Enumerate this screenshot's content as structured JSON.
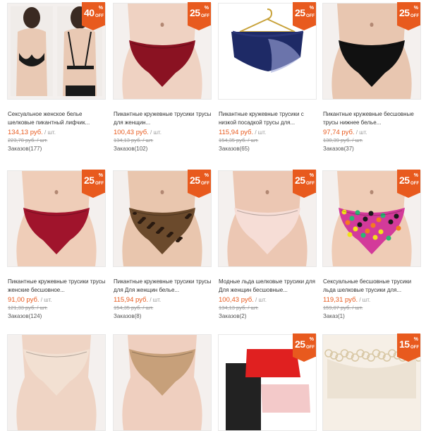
{
  "products": [
    {
      "discount": "40",
      "title": "Сексуальное женское белье шелковые пикантный лифчик...",
      "price": "134,13 руб.",
      "unit": "/ шт.",
      "old_price": "223,78 руб. / шт.",
      "orders": "Заказов(177)",
      "img": "bra-black",
      "skin": "#e9c9b4",
      "garment": "#1a1a1a"
    },
    {
      "discount": "25",
      "title": "Пикантные кружевные трусики трусы для женщин...",
      "price": "100,43 руб.",
      "unit": "/ шт.",
      "old_price": "134,13 руб. / шт.",
      "orders": "Заказов(102)",
      "img": "panty",
      "skin": "#efd2c2",
      "garment": "#8a1222"
    },
    {
      "discount": "25",
      "title": "Пикантные кружевные трусики с низкой посадкой трусы для...",
      "price": "115,94 руб.",
      "unit": "/ шт.",
      "old_price": "154,35 руб. / шт.",
      "orders": "Заказов(65)",
      "img": "hanger",
      "skin": "#ffffff",
      "garment": "#1e2a66"
    },
    {
      "discount": "25",
      "title": "Пикантные кружевные бесшовные трусы нижнее белье...",
      "price": "97,74 руб.",
      "unit": "/ шт.",
      "old_price": "130,39 руб. / шт.",
      "orders": "Заказов(37)",
      "img": "panty",
      "skin": "#e8c6b0",
      "garment": "#111111"
    },
    {
      "discount": "25",
      "title": "Пикантные кружевные трусики трусы женские бесшовное...",
      "price": "91,00 руб.",
      "unit": "/ шт.",
      "old_price": "121,33 руб. / шт.",
      "orders": "Заказов(124)",
      "img": "panty",
      "skin": "#efcdb8",
      "garment": "#a0142c"
    },
    {
      "discount": "25",
      "title": "Пикантные кружевные трусики трусы для Для женщин белье...",
      "price": "115,94 руб.",
      "unit": "/ шт.",
      "old_price": "154,35 руб. / шт.",
      "orders": "Заказов(8)",
      "img": "leopard",
      "skin": "#e9c6ae",
      "garment": "#6b4a2c"
    },
    {
      "discount": "25",
      "title": "Модные льда шелковые трусики для Для женщин бесшовные...",
      "price": "100,43 руб.",
      "unit": "/ шт.",
      "old_price": "134,13 руб. / шт.",
      "orders": "Заказов(2)",
      "img": "panty",
      "skin": "#ecc7b3",
      "garment": "#f6ddd6"
    },
    {
      "discount": "25",
      "title": "Сексуальные бесшовные трусики льда шелковые трусики для...",
      "price": "119,31 руб.",
      "unit": "/ шт.",
      "old_price": "159,07 руб. / шт.",
      "orders": "Заказ(1)",
      "img": "floral",
      "skin": "#efccb6",
      "garment": "#d33a9a"
    },
    {
      "discount": "",
      "title": "",
      "price": "",
      "unit": "",
      "old_price": "",
      "orders": "",
      "img": "panty-partial",
      "skin": "#efd4c4",
      "garment": "#f2e0d2"
    },
    {
      "discount": "",
      "title": "",
      "price": "",
      "unit": "",
      "old_price": "",
      "orders": "",
      "img": "panty-partial",
      "skin": "#efcfbf",
      "garment": "#c7a07a"
    },
    {
      "discount": "25",
      "title": "",
      "price": "",
      "unit": "",
      "old_price": "",
      "orders": "",
      "img": "flatlay",
      "skin": "#ffffff",
      "garment": "#e02020"
    },
    {
      "discount": "15",
      "title": "",
      "price": "",
      "unit": "",
      "old_price": "",
      "orders": "",
      "img": "lace-flat",
      "skin": "#f6efe6",
      "garment": "#d8c7a4"
    }
  ],
  "badge": {
    "pct": "%",
    "off": "OFF"
  },
  "colors": {
    "accent": "#e85a1e",
    "price": "#e85a1e"
  }
}
